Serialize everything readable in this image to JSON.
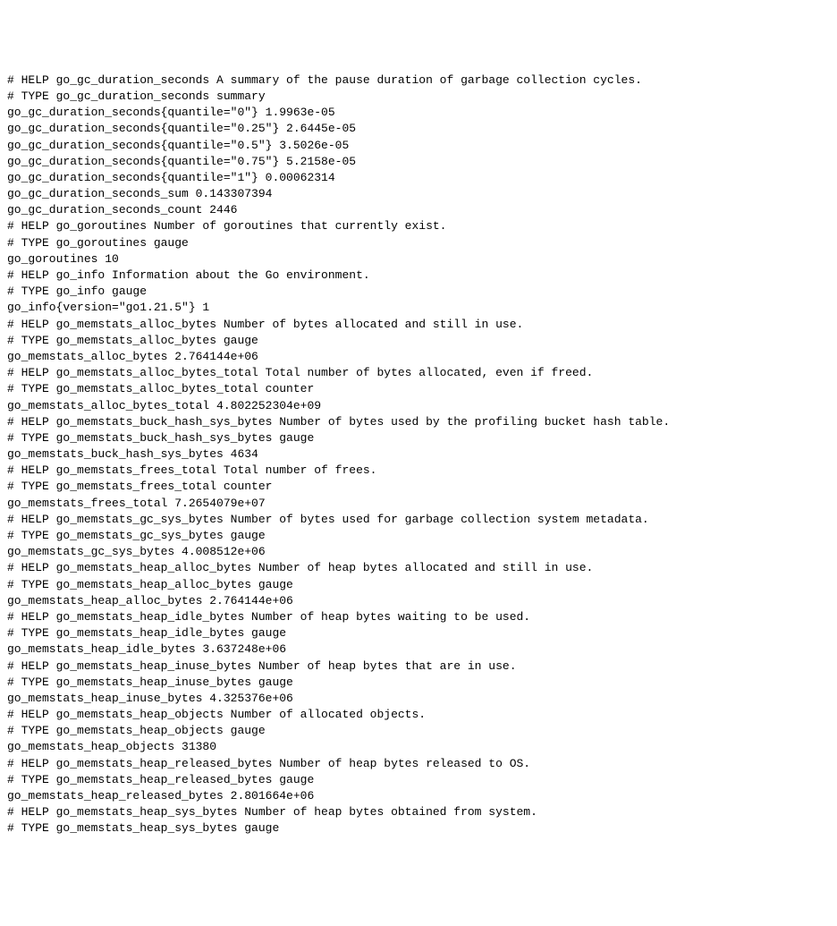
{
  "lines": [
    "# HELP go_gc_duration_seconds A summary of the pause duration of garbage collection cycles.",
    "# TYPE go_gc_duration_seconds summary",
    "go_gc_duration_seconds{quantile=\"0\"} 1.9963e-05",
    "go_gc_duration_seconds{quantile=\"0.25\"} 2.6445e-05",
    "go_gc_duration_seconds{quantile=\"0.5\"} 3.5026e-05",
    "go_gc_duration_seconds{quantile=\"0.75\"} 5.2158e-05",
    "go_gc_duration_seconds{quantile=\"1\"} 0.00062314",
    "go_gc_duration_seconds_sum 0.143307394",
    "go_gc_duration_seconds_count 2446",
    "# HELP go_goroutines Number of goroutines that currently exist.",
    "# TYPE go_goroutines gauge",
    "go_goroutines 10",
    "# HELP go_info Information about the Go environment.",
    "# TYPE go_info gauge",
    "go_info{version=\"go1.21.5\"} 1",
    "# HELP go_memstats_alloc_bytes Number of bytes allocated and still in use.",
    "# TYPE go_memstats_alloc_bytes gauge",
    "go_memstats_alloc_bytes 2.764144e+06",
    "# HELP go_memstats_alloc_bytes_total Total number of bytes allocated, even if freed.",
    "# TYPE go_memstats_alloc_bytes_total counter",
    "go_memstats_alloc_bytes_total 4.802252304e+09",
    "# HELP go_memstats_buck_hash_sys_bytes Number of bytes used by the profiling bucket hash table.",
    "# TYPE go_memstats_buck_hash_sys_bytes gauge",
    "go_memstats_buck_hash_sys_bytes 4634",
    "# HELP go_memstats_frees_total Total number of frees.",
    "# TYPE go_memstats_frees_total counter",
    "go_memstats_frees_total 7.2654079e+07",
    "# HELP go_memstats_gc_sys_bytes Number of bytes used for garbage collection system metadata.",
    "# TYPE go_memstats_gc_sys_bytes gauge",
    "go_memstats_gc_sys_bytes 4.008512e+06",
    "# HELP go_memstats_heap_alloc_bytes Number of heap bytes allocated and still in use.",
    "# TYPE go_memstats_heap_alloc_bytes gauge",
    "go_memstats_heap_alloc_bytes 2.764144e+06",
    "# HELP go_memstats_heap_idle_bytes Number of heap bytes waiting to be used.",
    "# TYPE go_memstats_heap_idle_bytes gauge",
    "go_memstats_heap_idle_bytes 3.637248e+06",
    "# HELP go_memstats_heap_inuse_bytes Number of heap bytes that are in use.",
    "# TYPE go_memstats_heap_inuse_bytes gauge",
    "go_memstats_heap_inuse_bytes 4.325376e+06",
    "# HELP go_memstats_heap_objects Number of allocated objects.",
    "# TYPE go_memstats_heap_objects gauge",
    "go_memstats_heap_objects 31380",
    "# HELP go_memstats_heap_released_bytes Number of heap bytes released to OS.",
    "# TYPE go_memstats_heap_released_bytes gauge",
    "go_memstats_heap_released_bytes 2.801664e+06",
    "# HELP go_memstats_heap_sys_bytes Number of heap bytes obtained from system.",
    "# TYPE go_memstats_heap_sys_bytes gauge"
  ]
}
